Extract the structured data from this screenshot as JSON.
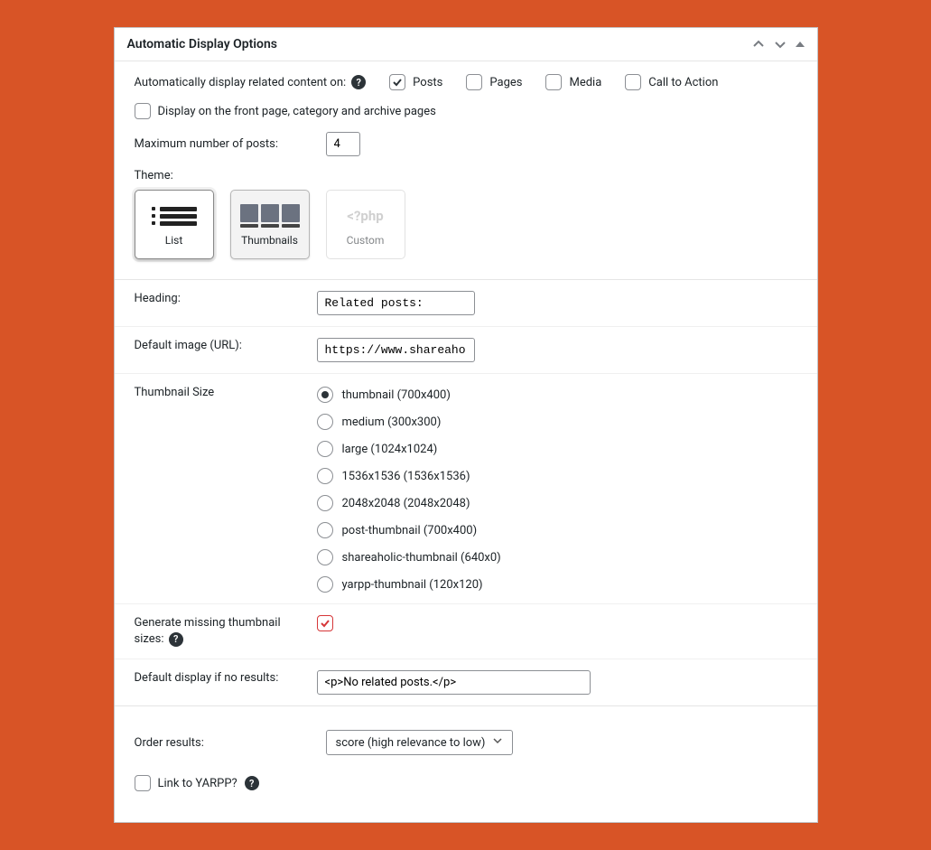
{
  "header": {
    "title": "Automatic Display Options"
  },
  "auto": {
    "label": "Automatically display related content on:",
    "posts": "Posts",
    "pages": "Pages",
    "media": "Media",
    "cta": "Call to Action"
  },
  "front": {
    "label": "Display on the front page, category and archive pages"
  },
  "max": {
    "label": "Maximum number of posts:",
    "value": "4"
  },
  "theme": {
    "label": "Theme:",
    "list": "List",
    "thumbnails": "Thumbnails",
    "custom": "Custom",
    "php": "<?php"
  },
  "heading": {
    "label": "Heading:",
    "value": "Related posts:"
  },
  "defimg": {
    "label": "Default image (URL):",
    "value": "https://www.shareaholic"
  },
  "thumbsize": {
    "label": "Thumbnail Size",
    "options": [
      "thumbnail (700x400)",
      "medium (300x300)",
      "large (1024x1024)",
      "1536x1536 (1536x1536)",
      "2048x2048 (2048x2048)",
      "post-thumbnail (700x400)",
      "shareaholic-thumbnail (640x0)",
      "yarpp-thumbnail (120x120)"
    ]
  },
  "genmissing": {
    "label": "Generate missing thumbnail sizes:"
  },
  "noresults": {
    "label": "Default display if no results:",
    "value": "<p>No related posts.</p>"
  },
  "order": {
    "label": "Order results:",
    "value": "score (high relevance to low)"
  },
  "link": {
    "label": "Link to YARPP?"
  }
}
